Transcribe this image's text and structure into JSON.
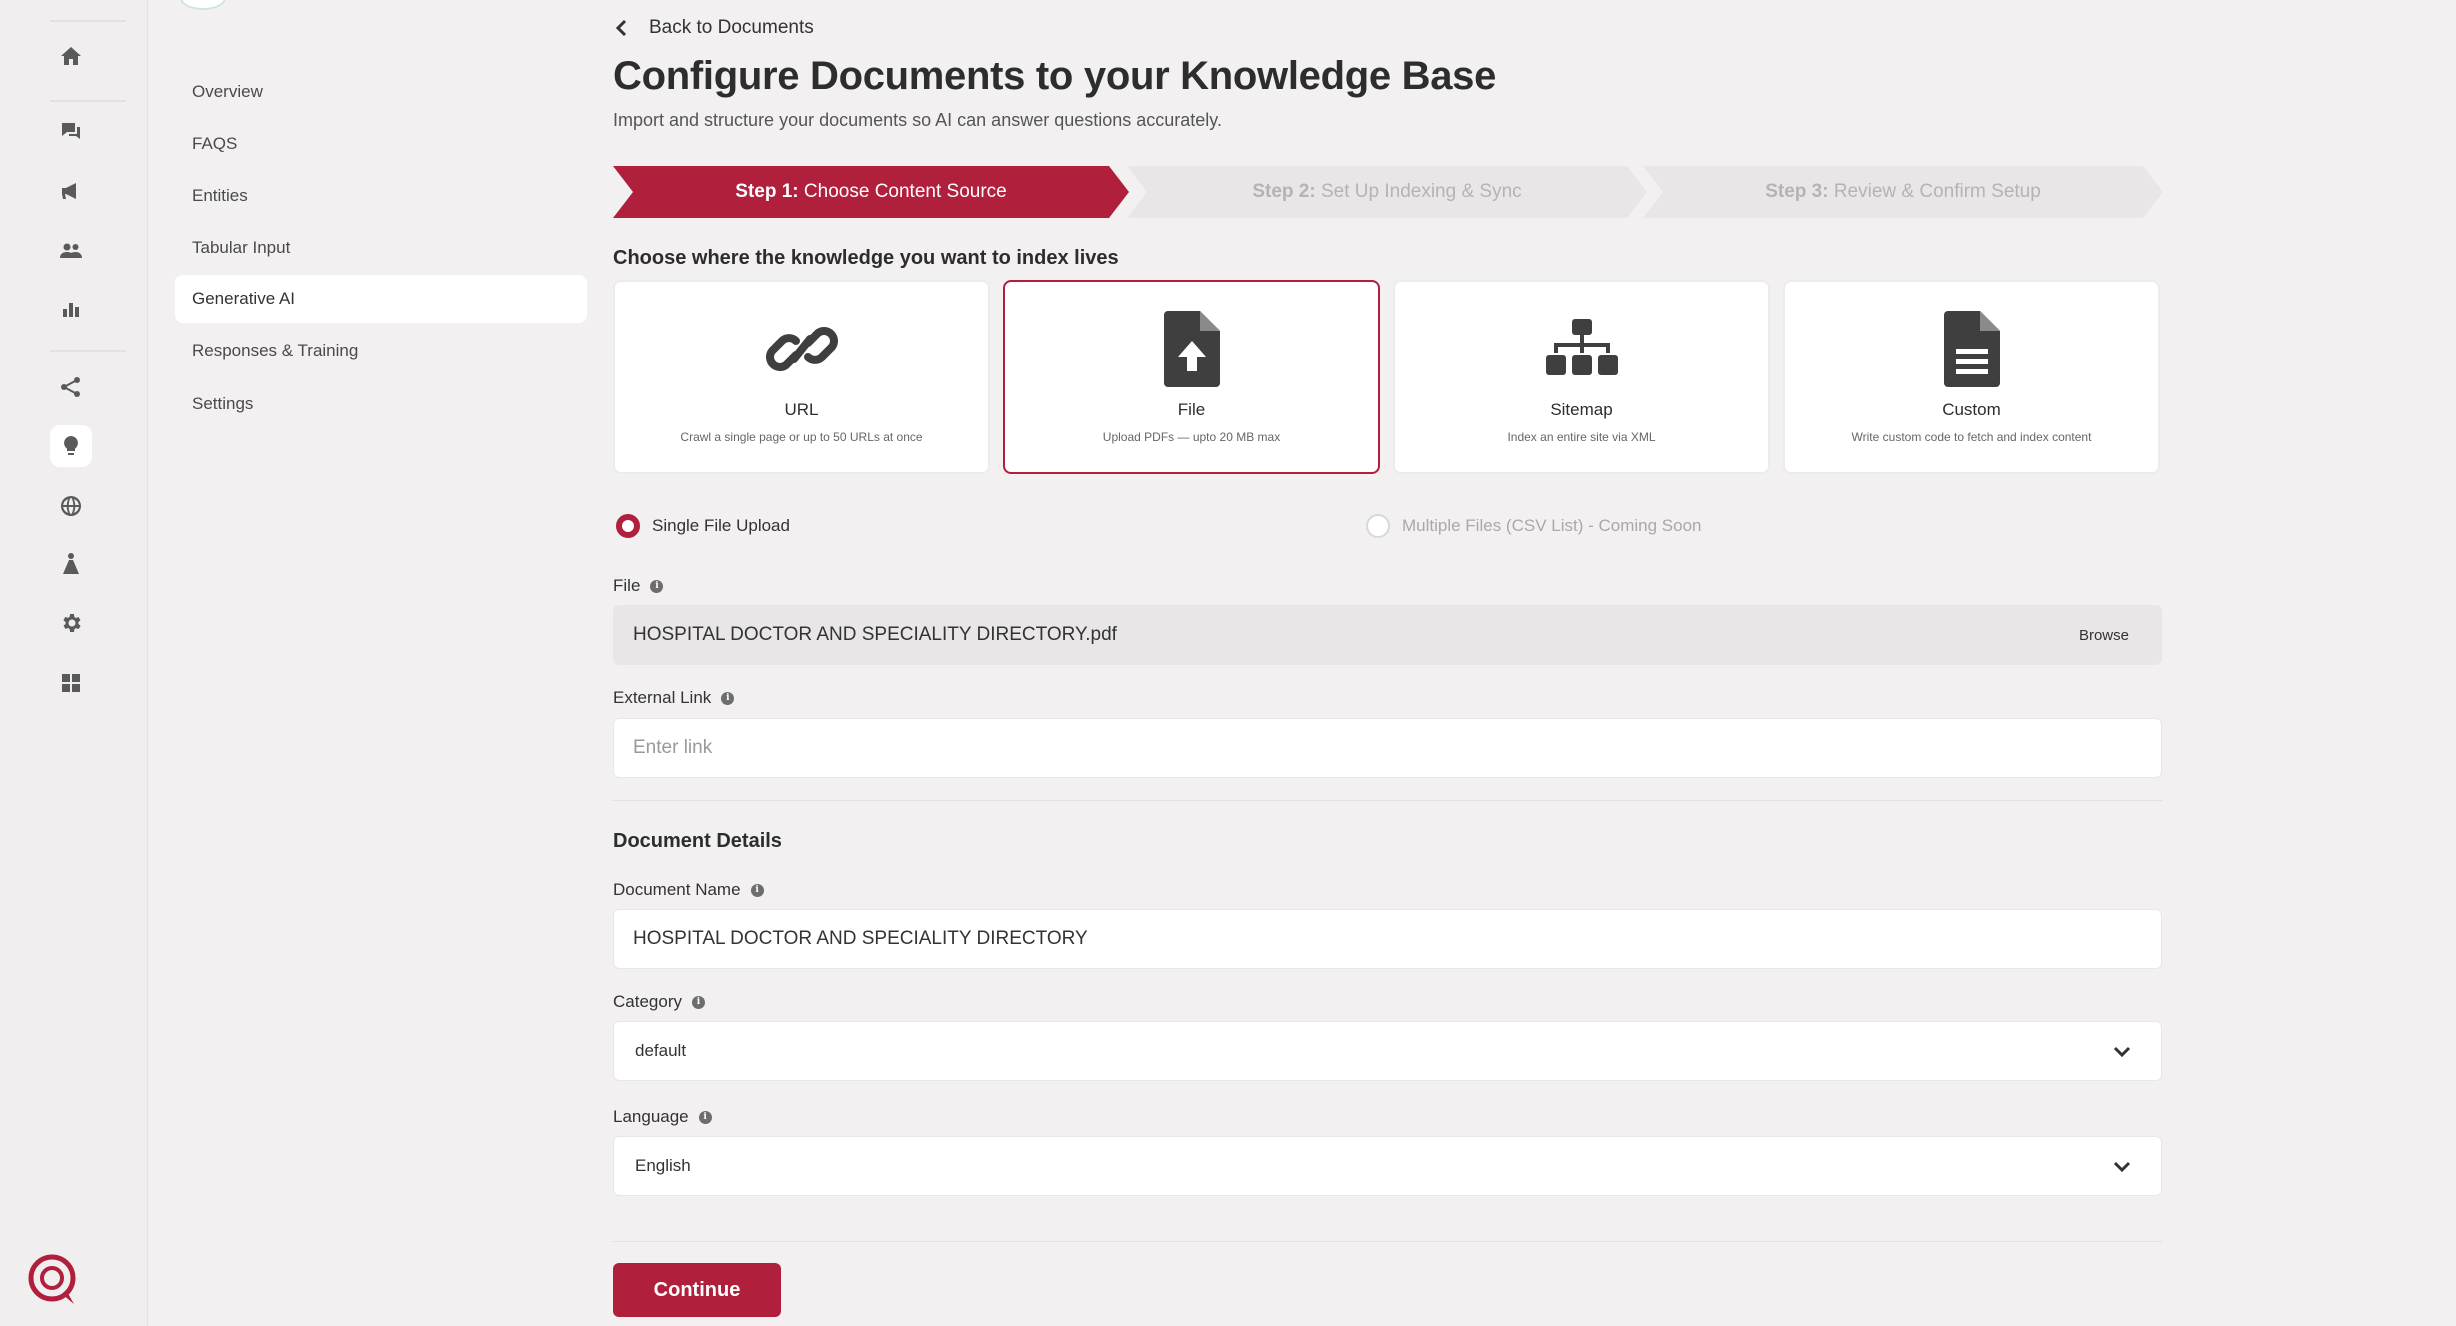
{
  "app": {
    "brand_color": "#b01f3c"
  },
  "rail": {
    "icons": [
      "home-icon",
      "chat-icon",
      "megaphone-icon",
      "users-icon",
      "bar-chart-icon",
      "share-icon",
      "lightbulb-icon",
      "globe-icon",
      "flow-icon",
      "gear-icon",
      "widgets-icon"
    ],
    "active": "lightbulb-icon"
  },
  "subnav": {
    "items": [
      {
        "label": "Overview"
      },
      {
        "label": "FAQS"
      },
      {
        "label": "Entities"
      },
      {
        "label": "Tabular Input"
      },
      {
        "label": "Generative AI"
      },
      {
        "label": "Responses & Training"
      },
      {
        "label": "Settings"
      }
    ],
    "active": "Generative AI"
  },
  "header": {
    "back_label": "Back to Documents",
    "title": "Configure Documents to your Knowledge Base",
    "subtitle": "Import and structure your documents so AI can answer questions accurately."
  },
  "steps": [
    {
      "prefix": "Step 1:",
      "label": "Choose Content Source",
      "active": true
    },
    {
      "prefix": "Step 2:",
      "label": "Set Up Indexing & Sync",
      "active": false
    },
    {
      "prefix": "Step 3:",
      "label": "Review & Confirm Setup",
      "active": false
    }
  ],
  "source": {
    "heading": "Choose where the knowledge you want to index lives",
    "cards": [
      {
        "icon": "link-icon",
        "title": "URL",
        "desc": "Crawl a single page or up to 50 URLs at once"
      },
      {
        "icon": "file-upload-icon",
        "title": "File",
        "desc": "Upload PDFs — upto 20 MB max"
      },
      {
        "icon": "sitemap-icon",
        "title": "Sitemap",
        "desc": "Index an entire site via XML"
      },
      {
        "icon": "document-icon",
        "title": "Custom",
        "desc": "Write custom code to fetch and index content"
      }
    ],
    "selected": "File"
  },
  "upload_mode": {
    "single_label": "Single File Upload",
    "multiple_label": "Multiple Files (CSV List) - Coming Soon",
    "selected": "single"
  },
  "form": {
    "file_label": "File",
    "file_value": "HOSPITAL DOCTOR AND SPECIALITY DIRECTORY.pdf",
    "browse_label": "Browse",
    "external_link_label": "External Link",
    "external_link_placeholder": "Enter link",
    "details_heading": "Document Details",
    "doc_name_label": "Document Name",
    "doc_name_value": "HOSPITAL DOCTOR AND SPECIALITY DIRECTORY",
    "category_label": "Category",
    "category_value": "default",
    "language_label": "Language",
    "language_value": "English",
    "info_glyph": "i"
  },
  "actions": {
    "continue_label": "Continue"
  }
}
